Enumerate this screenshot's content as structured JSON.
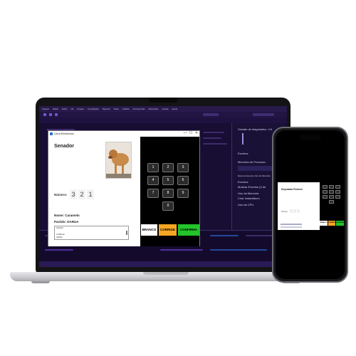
{
  "laptop": {
    "ide": {
      "menu_items": [
        "Arquivo",
        "Editar",
        "Exibir",
        "Git",
        "Projeto",
        "Compilação",
        "Depurar",
        "Teste",
        "Análise",
        "Ferramentas",
        "Extensões",
        "Janela",
        "Ajuda"
      ],
      "right_panel": {
        "title": "Sessão de diagnóstico: 4:5",
        "events_label": "Eventos",
        "memory_label": "Memória de Processo",
        "summary_tabs": [
          "Resumo",
          "Eventos",
          "Uso de Memória"
        ],
        "events_row": "Mostrar Eventos (0 de",
        "memory_use_label": "Uso da Memória",
        "snapshot_label": "Criar Instantâneo",
        "cpu_label": "Uso da CPU"
      }
    },
    "app": {
      "window_title": "Urna Eletrônica",
      "controls": [
        "—",
        "☐",
        "✕"
      ],
      "role_title": "Senador",
      "number_label": "Número:",
      "number_digits": [
        "3",
        "2",
        "1"
      ],
      "name_line": "Nome: Caramelo",
      "party_line": "Partido: DARUA",
      "notes_lines": [
        "APERTE",
        "",
        "CORRIGE",
        "VERDE"
      ],
      "keypad": [
        "1",
        "2",
        "3",
        "4",
        "5",
        "6",
        "7",
        "8",
        "9",
        "0"
      ],
      "buttons": {
        "branco": "BRANCO",
        "corrige": "CORRIGE",
        "confirma": "CONFIRMA"
      }
    }
  },
  "phone": {
    "app": {
      "role_title": "Deputado Federal",
      "number_label": "Número:",
      "buttons": {
        "branco": "BRANCO",
        "corrige": "CORRIGE",
        "confirma": "CONFIRMA"
      }
    }
  },
  "colors": {
    "ide_background": "#1b1038",
    "branco_button": "#ffffff",
    "corrige_button": "#f5a623",
    "confirma_button": "#22c52a",
    "keypad_key": "#2b2b2b"
  }
}
